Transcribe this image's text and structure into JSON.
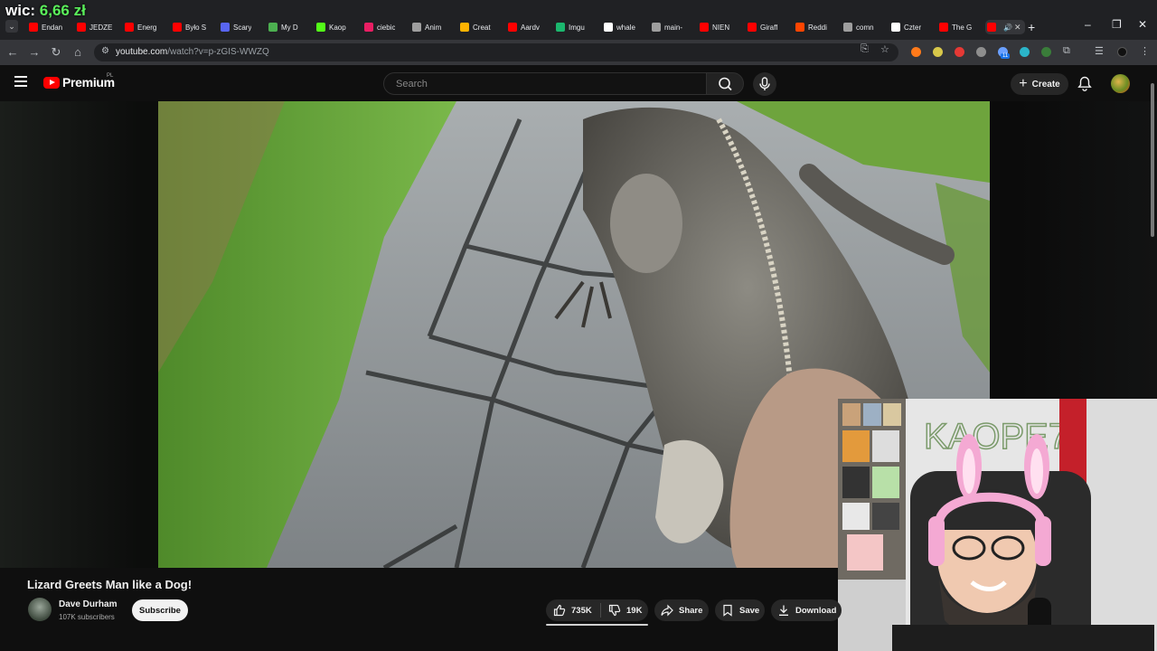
{
  "overlay": {
    "label": "wic:",
    "amount": "6,66 zł"
  },
  "browser": {
    "tabs": [
      {
        "title": "Endan",
        "favicon_color": "#ff0000"
      },
      {
        "title": "JEDZE",
        "favicon_color": "#ff0000"
      },
      {
        "title": "Energ",
        "favicon_color": "#ff0000"
      },
      {
        "title": "Było S",
        "favicon_color": "#ff0000"
      },
      {
        "title": "Scary",
        "favicon_color": "#5865f2"
      },
      {
        "title": "My D",
        "favicon_color": "#4caf50"
      },
      {
        "title": "Kaop",
        "favicon_color": "#53fc18"
      },
      {
        "title": "ciebic",
        "favicon_color": "#e91e63"
      },
      {
        "title": "Anim",
        "favicon_color": "#9e9e9e"
      },
      {
        "title": "Creat",
        "favicon_color": "#ffb300"
      },
      {
        "title": "Aardv",
        "favicon_color": "#ff0000"
      },
      {
        "title": "Imgu",
        "favicon_color": "#1bb76e"
      },
      {
        "title": "whale",
        "favicon_color": "#ffffff"
      },
      {
        "title": "main-",
        "favicon_color": "#9e9e9e"
      },
      {
        "title": "NIEN",
        "favicon_color": "#ff0000"
      },
      {
        "title": "Giraff",
        "favicon_color": "#ff0000"
      },
      {
        "title": "Reddi",
        "favicon_color": "#ff4500"
      },
      {
        "title": "comn",
        "favicon_color": "#9e9e9e"
      },
      {
        "title": "Czter",
        "favicon_color": "#ffffff"
      },
      {
        "title": "The G",
        "favicon_color": "#ff0000"
      }
    ],
    "active_tab_favicon_color": "#ff0000",
    "url_host": "youtube.com",
    "url_path": "/watch?v=p-zGIS-WWZQ"
  },
  "youtube": {
    "logo_text": "Premium",
    "country_code": "PL",
    "search_placeholder": "Search",
    "create_label": "Create",
    "video_title": "Lizard Greets Man like a Dog!",
    "channel_name": "Dave Durham",
    "channel_subs": "107K subscribers",
    "subscribe_label": "Subscribe",
    "likes": "735K",
    "dislikes": "19K",
    "share_label": "Share",
    "save_label": "Save",
    "download_label": "Download"
  },
  "webcam": {
    "sign_text": "KAOPE7"
  },
  "colors": {
    "brand_red": "#ff0000",
    "money_green": "#5af05a",
    "bg": "#0f0f0f"
  }
}
